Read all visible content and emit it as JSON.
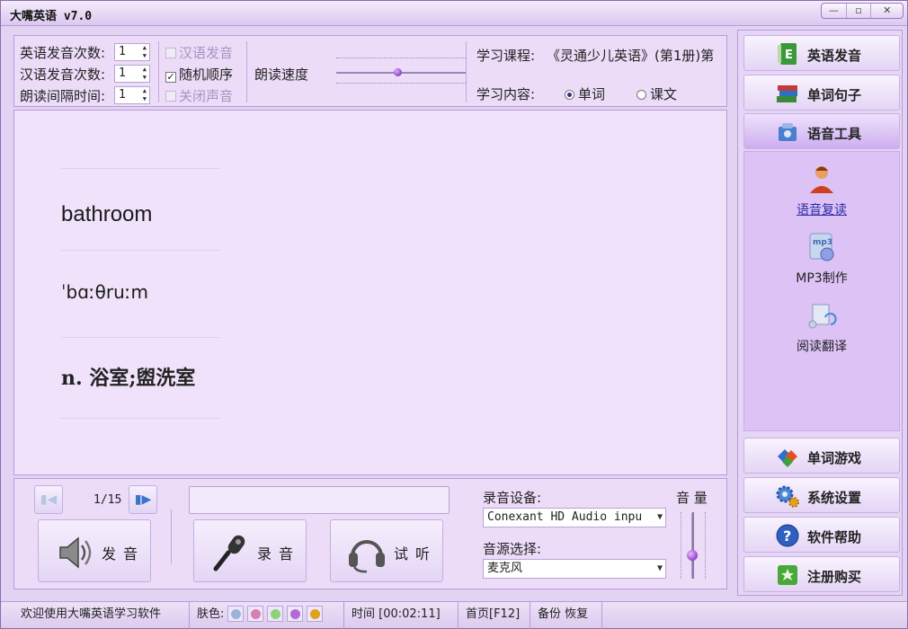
{
  "window": {
    "title": "大嘴英语 v7.0",
    "minimize": "—",
    "maximize": "▫",
    "close": "✕"
  },
  "settings": {
    "english_count_label": "英语发音次数:",
    "english_count_value": "1",
    "chinese_count_label": "汉语发音次数:",
    "chinese_count_value": "1",
    "interval_label": "朗读间隔时间:",
    "interval_value": "1",
    "chk_chinese": {
      "label": "汉语发音",
      "checked": false,
      "disabled": true
    },
    "chk_random": {
      "label": "随机顺序",
      "checked": true,
      "disabled": false
    },
    "chk_mute": {
      "label": "关闭声音",
      "checked": false,
      "disabled": true
    },
    "speed_label": "朗读速度",
    "speed_value": 0.47,
    "course_label": "学习课程:",
    "course_value": "《灵通少儿英语》(第1册)第",
    "content_label": "学习内容:",
    "content_options": [
      "单词",
      "课文"
    ],
    "content_selected": "单词"
  },
  "word": {
    "english": "bathroom",
    "phonetic": "ˈbɑːθruːm",
    "meaning": "n. 浴室;盥洗室"
  },
  "controls": {
    "prev_icon": "skip-prev-icon",
    "next_icon": "skip-next-icon",
    "page": "1/15",
    "pronounce_label": "发音",
    "record_label": "录音",
    "listen_label": "试听",
    "rec_device_label": "录音设备:",
    "rec_device_value": "Conexant HD Audio inpu",
    "source_label": "音源选择:",
    "source_value": "麦克风",
    "volume_label": "音 量",
    "volume_value": 0.35
  },
  "sidebar": {
    "items": [
      {
        "label": "英语发音",
        "icon": "book-e-icon"
      },
      {
        "label": "单词句子",
        "icon": "books-icon"
      },
      {
        "label": "语音工具",
        "icon": "tools-icon"
      },
      {
        "label": "单词游戏",
        "icon": "game-icon"
      },
      {
        "label": "系统设置",
        "icon": "gear-icon"
      },
      {
        "label": "软件帮助",
        "icon": "help-icon"
      },
      {
        "label": "注册购买",
        "icon": "register-icon"
      }
    ],
    "tools": [
      {
        "label": "语音复读",
        "icon": "person-repeat-icon"
      },
      {
        "label": "MP3制作",
        "icon": "mp3-icon"
      },
      {
        "label": "阅读翻译",
        "icon": "scroll-icon"
      }
    ]
  },
  "status": {
    "welcome": "欢迎使用大嘴英语学习软件",
    "skin_label": "肤色:",
    "skin_colors": [
      "#9bb3d6",
      "#d77fb0",
      "#8fd07a",
      "#b26ad6",
      "#e0a020"
    ],
    "time": "时间 [00:02:11]",
    "home": "首页[F12]",
    "backup": "备份",
    "restore": "恢复"
  }
}
